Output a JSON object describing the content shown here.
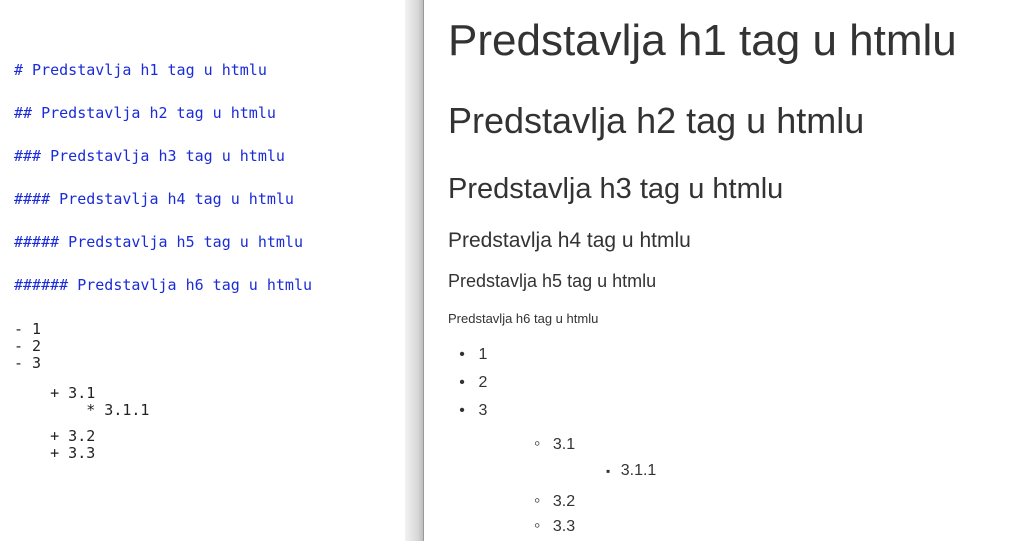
{
  "editor": {
    "lines": [
      "# Predstavlja h1 tag u htmlu",
      "## Predstavlja h2 tag u htmlu",
      "### Predstavlja h3 tag u htmlu",
      "#### Predstavlja h4 tag u htmlu",
      "##### Predstavlja h5 tag u htmlu",
      "###### Predstavlja h6 tag u htmlu",
      "- 1",
      "- 2",
      "- 3",
      "    + 3.1",
      "        * 3.1.1",
      "    + 3.2",
      "    + 3.3"
    ]
  },
  "preview": {
    "h1": "Predstavlja h1 tag u htmlu",
    "h2": "Predstavlja h2 tag u htmlu",
    "h3": "Predstavlja h3 tag u htmlu",
    "h4": "Predstavlja h4 tag u htmlu",
    "h5": "Predstavlja h5 tag u htmlu",
    "h6": "Predstavlja h6 tag u htmlu",
    "list": [
      {
        "text": "1",
        "marker": "disc"
      },
      {
        "text": "2",
        "marker": "disc"
      },
      {
        "text": "3",
        "marker": "disc"
      },
      {
        "text": "3.1",
        "marker": "circle"
      },
      {
        "text": "3.1.1",
        "marker": "square"
      },
      {
        "text": "3.2",
        "marker": "circle"
      },
      {
        "text": "3.3",
        "marker": "circle"
      }
    ]
  },
  "colors": {
    "markdown_heading": "#1a2bd8",
    "markdown_plain": "#222222",
    "preview_text": "#333333"
  }
}
